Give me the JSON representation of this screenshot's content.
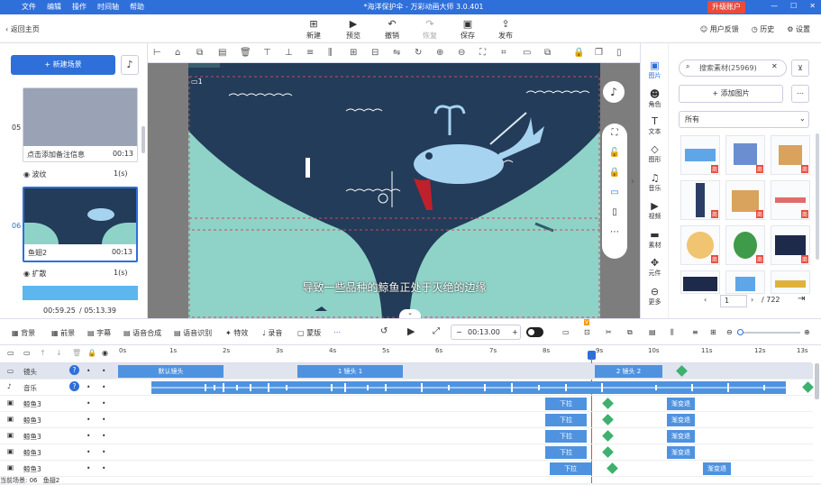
{
  "app": {
    "title": "*海洋保护伞 - 万彩动画大师 3.0.401",
    "menu": [
      "文件",
      "编辑",
      "操作",
      "时间轴",
      "帮助"
    ],
    "upgrade": "升级账户"
  },
  "toolbar": {
    "back": "返回主页",
    "new": "新建",
    "preview": "预览",
    "undo": "撤销",
    "redo": "恢复",
    "save": "保存",
    "publish": "发布",
    "feedback": "用户反馈",
    "history": "历史",
    "settings": "设置"
  },
  "left": {
    "new_scene": "+ 新建场景",
    "scenes": [
      {
        "num": "05",
        "caption": "点击添加备注信息",
        "duration": "00:13",
        "trans": "波纹",
        "trans_dur": "1(s)"
      },
      {
        "num": "06",
        "caption": "鱼翅2",
        "duration": "00:13",
        "trans": "扩散",
        "trans_dur": "1(s)"
      }
    ],
    "time_current": "00:59.25",
    "time_total": "/ 05:13.39"
  },
  "canvas": {
    "subtitle": "导致一些品种的鲸鱼正处于灭绝的边缘",
    "layer_num": "1"
  },
  "rightcat": [
    "图片",
    "角色",
    "文本",
    "图形",
    "音乐",
    "视频",
    "素材",
    "元件",
    "更多"
  ],
  "rightpanel": {
    "search": "搜索素材(25969)",
    "add_image": "+ 添加图片",
    "filter": "所有",
    "page": "1",
    "pages": "/ 722"
  },
  "tlbar": {
    "items": [
      "背景",
      "前景",
      "字幕",
      "语音合成",
      "语音识别",
      "特效",
      "录音",
      "蒙版"
    ],
    "time": "00:13.00"
  },
  "ruler": [
    "0s",
    "1s",
    "2s",
    "3s",
    "4s",
    "5s",
    "6s",
    "7s",
    "8s",
    "9s",
    "10s",
    "11s",
    "12s",
    "13s"
  ],
  "tracks": [
    {
      "name": "镜头",
      "clips": [
        "默认镜头",
        "1 镜头 1",
        "2 镜头 2"
      ]
    },
    {
      "name": "音乐"
    },
    {
      "name": "鲸鱼3",
      "a": "下拉",
      "b": "渐变退"
    },
    {
      "name": "鲸鱼3",
      "a": "下拉",
      "b": "渐变退"
    },
    {
      "name": "鲸鱼3",
      "a": "下拉",
      "b": "渐变退"
    },
    {
      "name": "鲸鱼3",
      "a": "下拉",
      "b": "渐变退"
    },
    {
      "name": "鲸鱼3",
      "a": "下拉",
      "b": "渐变退"
    }
  ],
  "status": {
    "scene": "当前场景: 06",
    "name": "鱼翅2"
  }
}
